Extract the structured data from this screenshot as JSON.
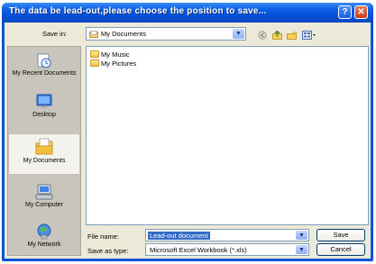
{
  "dialog": {
    "title": "The data be lead-out,please choose the position to save...",
    "help_glyph": "?",
    "close_glyph": "✕"
  },
  "save_in": {
    "label": "Save in:",
    "value": "My Documents"
  },
  "toolbar_icons": [
    "back-icon",
    "up-folder-icon",
    "new-folder-icon",
    "views-menu-icon"
  ],
  "places": [
    {
      "label": "My Recent Documents",
      "icon": "recent-documents-icon"
    },
    {
      "label": "Desktop",
      "icon": "desktop-icon"
    },
    {
      "label": "My Documents",
      "icon": "my-documents-icon",
      "selected": true
    },
    {
      "label": "My Computer",
      "icon": "my-computer-icon"
    },
    {
      "label": "My Network",
      "icon": "my-network-icon"
    }
  ],
  "files": [
    {
      "name": "My Music",
      "icon": "folder-icon"
    },
    {
      "name": "My Pictures",
      "icon": "folder-icon"
    }
  ],
  "file_name": {
    "label": "File name:",
    "value": "Lead-out document"
  },
  "save_as_type": {
    "label": "Save as type:",
    "value": "Microsoft Excel Workbook (*.xls)"
  },
  "buttons": {
    "save": "Save",
    "cancel": "Cancel"
  },
  "colors": {
    "titlebar": "#0550d6",
    "dialog_face": "#ece9d8",
    "selection": "#316ac5"
  }
}
